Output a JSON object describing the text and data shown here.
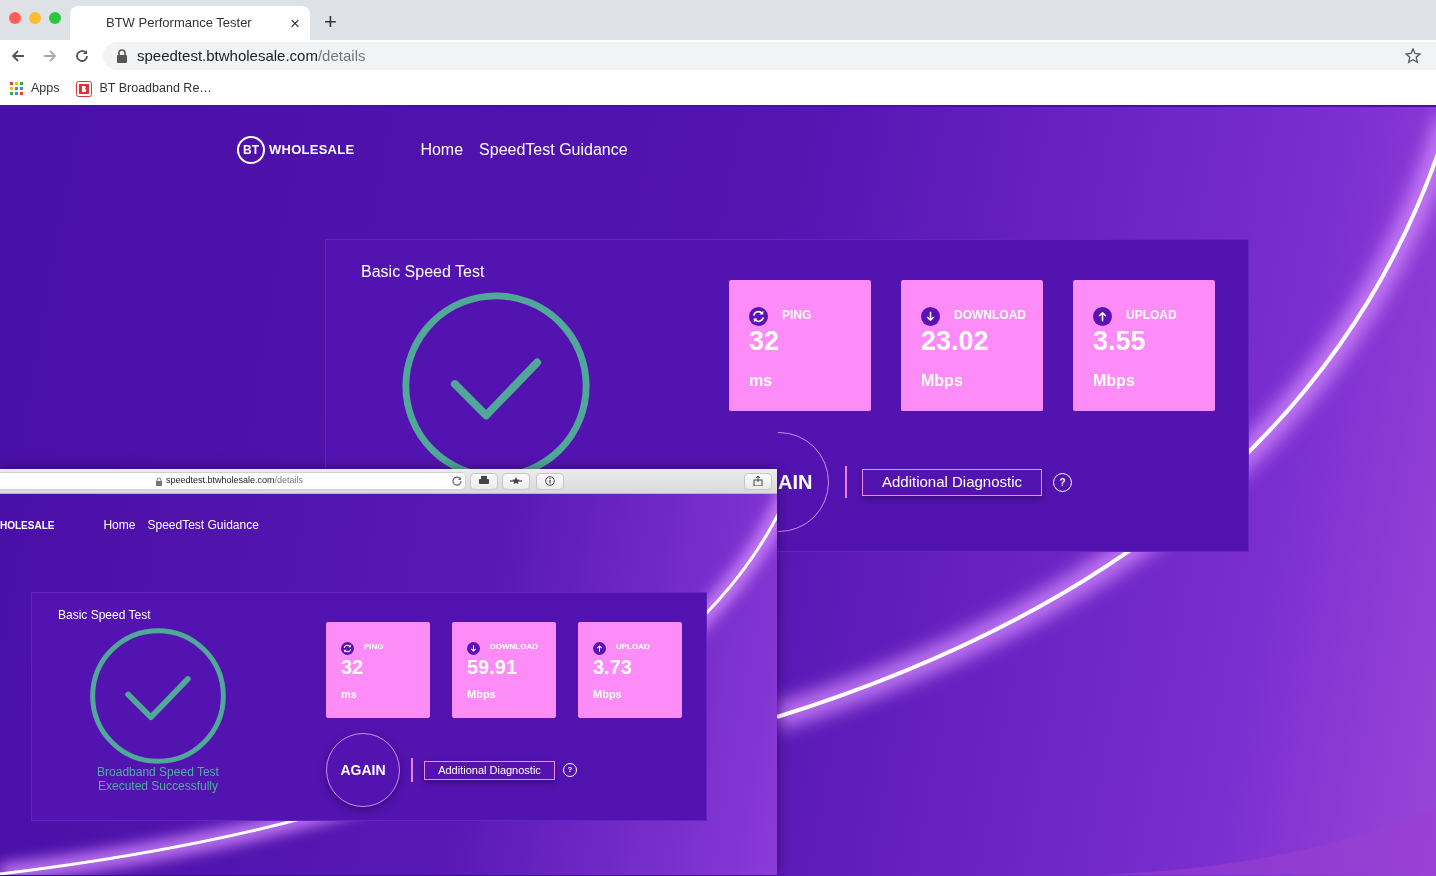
{
  "browser": {
    "tab": {
      "title": "BTW Performance Tester",
      "close": "×"
    },
    "new_tab": "+",
    "url": {
      "host": "speedtest.btwholesale.com",
      "path": "/details"
    },
    "bookmarks": [
      {
        "kind": "apps",
        "label": "Apps"
      },
      {
        "kind": "site",
        "label": "BT Broadband Re…"
      }
    ]
  },
  "page": {
    "logo": {
      "mark": "BT",
      "text": "WHOLESALE"
    },
    "nav": [
      "Home",
      "SpeedTest Guidance"
    ],
    "panel": {
      "title": "Basic Speed Test",
      "metrics": [
        {
          "kind": "ping",
          "label": "PING",
          "value": "32",
          "unit": "ms"
        },
        {
          "kind": "download",
          "label": "DOWNLOAD",
          "value": "23.02",
          "unit": "Mbps"
        },
        {
          "kind": "upload",
          "label": "UPLOAD",
          "value": "3.55",
          "unit": "Mbps"
        }
      ],
      "again_button": "AIN",
      "diagnostic_button": "Additional Diagnostic",
      "help": "?"
    }
  },
  "overlay_window": {
    "url": {
      "host": "speedtest.btwholesale.com",
      "path": "/details"
    },
    "logo_text": "HOLESALE",
    "nav": [
      "Home",
      "SpeedTest Guidance"
    ],
    "panel": {
      "title": "Basic Speed Test",
      "status_lines": [
        "Broadband Speed Test",
        "Executed Successfully"
      ],
      "metrics": [
        {
          "kind": "ping",
          "label": "PING",
          "value": "32",
          "unit": "ms"
        },
        {
          "kind": "download",
          "label": "DOWNLOAD",
          "value": "59.91",
          "unit": "Mbps"
        },
        {
          "kind": "upload",
          "label": "UPLOAD",
          "value": "3.73",
          "unit": "Mbps"
        }
      ],
      "again_button": "AGAIN",
      "diagnostic_button": "Additional Diagnostic",
      "help": "?"
    }
  }
}
